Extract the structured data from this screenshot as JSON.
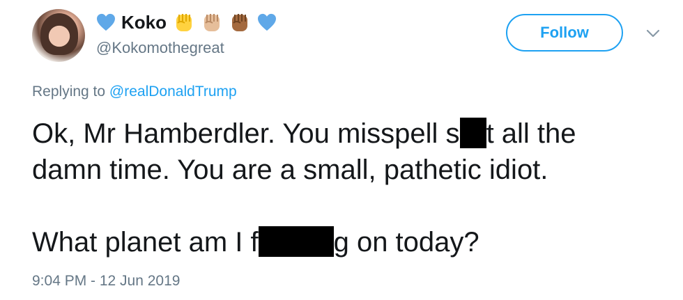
{
  "user": {
    "display_name": "Koko",
    "handle": "@Kokomothegreat",
    "emoji_icons": [
      "blue-heart",
      "raised-fist-yellow",
      "raised-fist-light",
      "raised-fist-medium-dark",
      "blue-heart"
    ]
  },
  "follow_button": {
    "label": "Follow"
  },
  "reply": {
    "prefix": "Replying to ",
    "mention": "@realDonaldTrump"
  },
  "tweet": {
    "line1_a": "Ok, Mr Hamberdler. You misspell s",
    "line1_b": "t all the",
    "line2": "damn time. You are a small, pathetic idiot.",
    "line3_a": "What planet am I f",
    "line3_b": "g on today?"
  },
  "timestamp": "9:04 PM - 12 Jun 2019",
  "colors": {
    "accent": "#1da1f2",
    "secondary_text": "#657786",
    "heart": "#5fa8e8",
    "redaction": "#000000"
  }
}
